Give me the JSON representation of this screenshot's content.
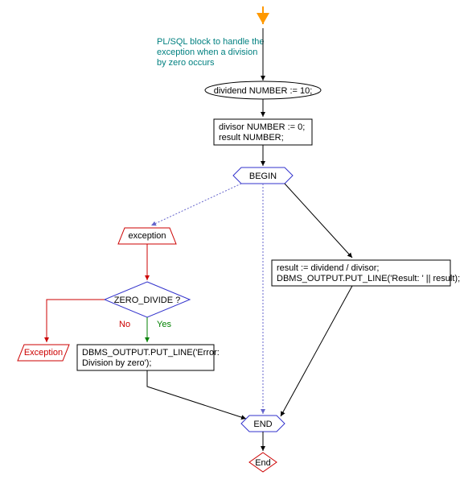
{
  "caption": {
    "line1": "PL/SQL block to handle the",
    "line2": "exception when a division",
    "line3": "by zero occurs"
  },
  "nodes": {
    "start_terminal": "dividend NUMBER := 10;",
    "declare_box": {
      "line1": "divisor  NUMBER := 0;",
      "line2": "result NUMBER;"
    },
    "begin_label": "BEGIN",
    "exception_label": "exception",
    "decision": "ZERO_DIVIDE ?",
    "decision_no": "No",
    "decision_yes": "Yes",
    "exception_result": "Exception",
    "output_error": {
      "line1": "DBMS_OUTPUT.PUT_LINE('Error:",
      "line2": "Division by zero');"
    },
    "main_block": {
      "line1": "result := dividend / divisor;",
      "line2": "DBMS_OUTPUT.PUT_LINE('Result: ' || result);"
    },
    "end_label": "END",
    "final_end": "End"
  }
}
